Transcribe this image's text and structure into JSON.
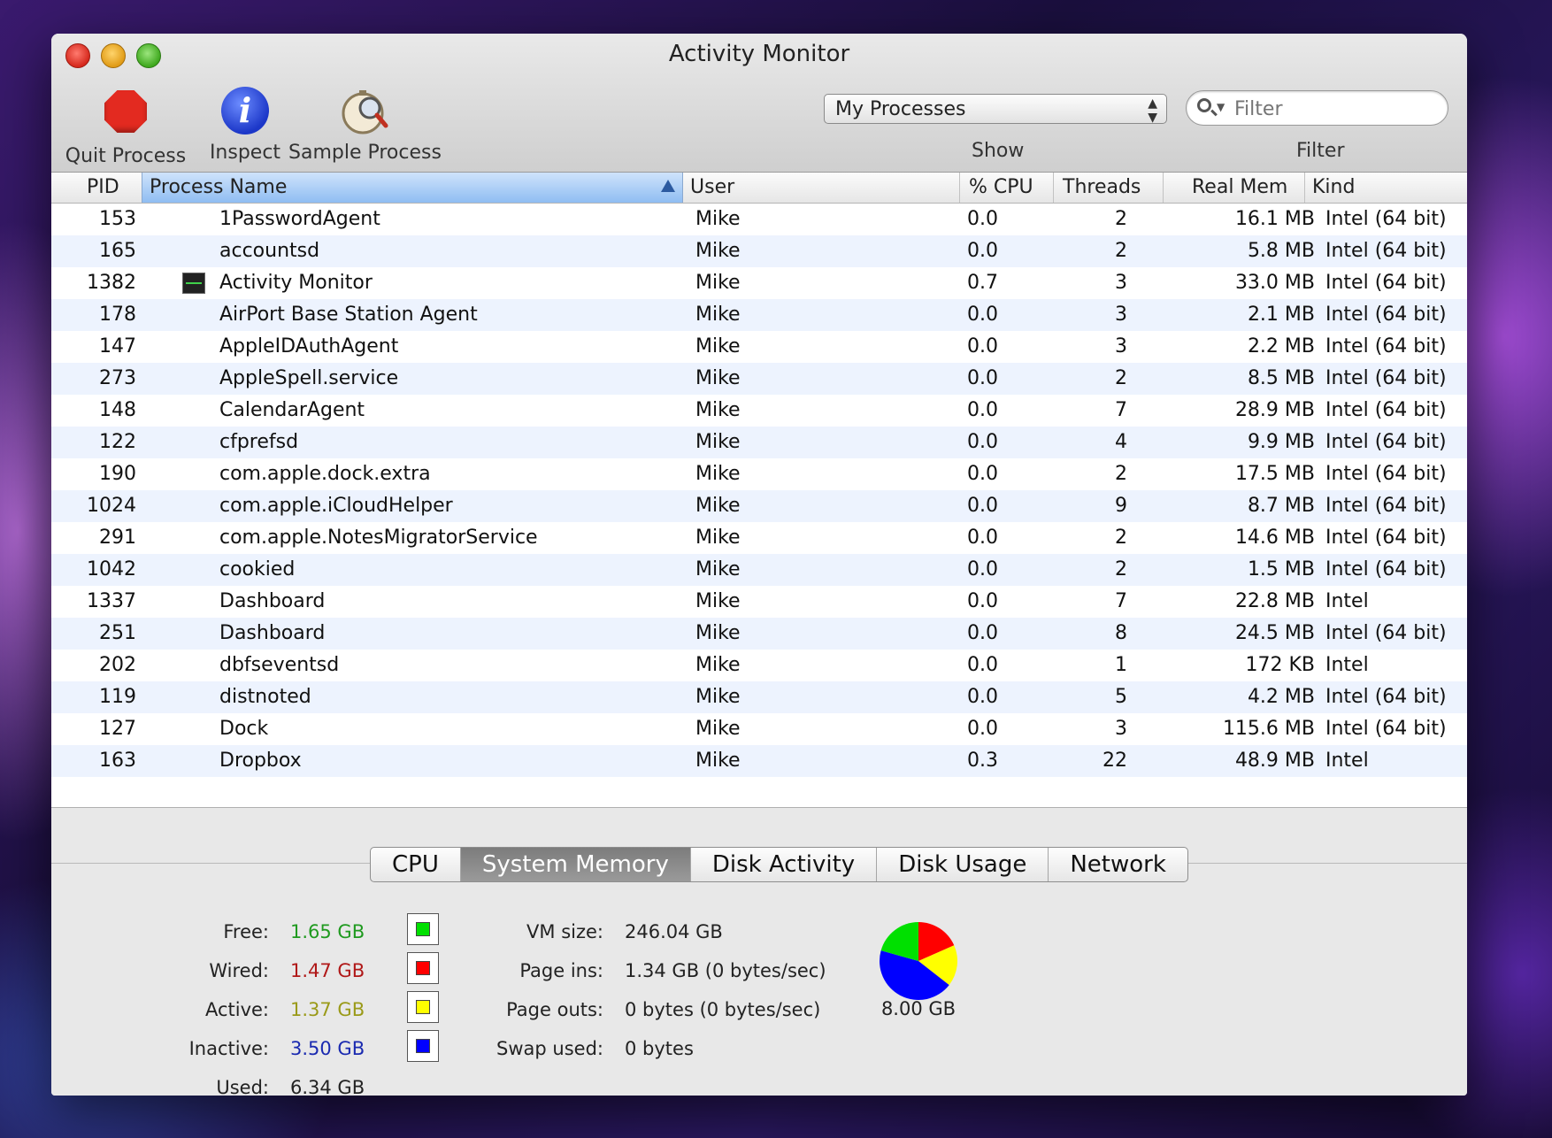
{
  "window": {
    "title": "Activity Monitor"
  },
  "toolbar": {
    "quit_label": "Quit Process",
    "inspect_label": "Inspect",
    "sample_label": "Sample Process",
    "show_value": "My Processes",
    "show_label": "Show",
    "filter_placeholder": "Filter",
    "filter_label": "Filter"
  },
  "table": {
    "columns": {
      "pid": "PID",
      "name": "Process Name",
      "user": "User",
      "cpu": "% CPU",
      "threads": "Threads",
      "mem": "Real Mem",
      "kind": "Kind"
    },
    "rows": [
      {
        "pid": "153",
        "name": "1PasswordAgent",
        "user": "Mike",
        "cpu": "0.0",
        "threads": "2",
        "mem": "16.1 MB",
        "kind": "Intel (64 bit)"
      },
      {
        "pid": "165",
        "name": "accountsd",
        "user": "Mike",
        "cpu": "0.0",
        "threads": "2",
        "mem": "5.8 MB",
        "kind": "Intel (64 bit)"
      },
      {
        "pid": "1382",
        "name": "Activity Monitor",
        "user": "Mike",
        "cpu": "0.7",
        "threads": "3",
        "mem": "33.0 MB",
        "kind": "Intel (64 bit)"
      },
      {
        "pid": "178",
        "name": "AirPort Base Station Agent",
        "user": "Mike",
        "cpu": "0.0",
        "threads": "3",
        "mem": "2.1 MB",
        "kind": "Intel (64 bit)"
      },
      {
        "pid": "147",
        "name": "AppleIDAuthAgent",
        "user": "Mike",
        "cpu": "0.0",
        "threads": "3",
        "mem": "2.2 MB",
        "kind": "Intel (64 bit)"
      },
      {
        "pid": "273",
        "name": "AppleSpell.service",
        "user": "Mike",
        "cpu": "0.0",
        "threads": "2",
        "mem": "8.5 MB",
        "kind": "Intel (64 bit)"
      },
      {
        "pid": "148",
        "name": "CalendarAgent",
        "user": "Mike",
        "cpu": "0.0",
        "threads": "7",
        "mem": "28.9 MB",
        "kind": "Intel (64 bit)"
      },
      {
        "pid": "122",
        "name": "cfprefsd",
        "user": "Mike",
        "cpu": "0.0",
        "threads": "4",
        "mem": "9.9 MB",
        "kind": "Intel (64 bit)"
      },
      {
        "pid": "190",
        "name": "com.apple.dock.extra",
        "user": "Mike",
        "cpu": "0.0",
        "threads": "2",
        "mem": "17.5 MB",
        "kind": "Intel (64 bit)"
      },
      {
        "pid": "1024",
        "name": "com.apple.iCloudHelper",
        "user": "Mike",
        "cpu": "0.0",
        "threads": "9",
        "mem": "8.7 MB",
        "kind": "Intel (64 bit)"
      },
      {
        "pid": "291",
        "name": "com.apple.NotesMigratorService",
        "user": "Mike",
        "cpu": "0.0",
        "threads": "2",
        "mem": "14.6 MB",
        "kind": "Intel (64 bit)"
      },
      {
        "pid": "1042",
        "name": "cookied",
        "user": "Mike",
        "cpu": "0.0",
        "threads": "2",
        "mem": "1.5 MB",
        "kind": "Intel (64 bit)"
      },
      {
        "pid": "1337",
        "name": "Dashboard",
        "user": "Mike",
        "cpu": "0.0",
        "threads": "7",
        "mem": "22.8 MB",
        "kind": "Intel"
      },
      {
        "pid": "251",
        "name": "Dashboard",
        "user": "Mike",
        "cpu": "0.0",
        "threads": "8",
        "mem": "24.5 MB",
        "kind": "Intel (64 bit)"
      },
      {
        "pid": "202",
        "name": "dbfseventsd",
        "user": "Mike",
        "cpu": "0.0",
        "threads": "1",
        "mem": "172 KB",
        "kind": "Intel"
      },
      {
        "pid": "119",
        "name": "distnoted",
        "user": "Mike",
        "cpu": "0.0",
        "threads": "5",
        "mem": "4.2 MB",
        "kind": "Intel (64 bit)"
      },
      {
        "pid": "127",
        "name": "Dock",
        "user": "Mike",
        "cpu": "0.0",
        "threads": "3",
        "mem": "115.6 MB",
        "kind": "Intel (64 bit)"
      },
      {
        "pid": "163",
        "name": "Dropbox",
        "user": "Mike",
        "cpu": "0.3",
        "threads": "22",
        "mem": "48.9 MB",
        "kind": "Intel"
      }
    ]
  },
  "tabs": [
    "CPU",
    "System Memory",
    "Disk Activity",
    "Disk Usage",
    "Network"
  ],
  "active_tab": "System Memory",
  "memory": {
    "free": {
      "label": "Free:",
      "value": "1.65 GB",
      "color": "#1f9a1f",
      "swatch": "#00e000"
    },
    "wired": {
      "label": "Wired:",
      "value": "1.47 GB",
      "color": "#b01818",
      "swatch": "#ff0000"
    },
    "active": {
      "label": "Active:",
      "value": "1.37 GB",
      "color": "#9a9a18",
      "swatch": "#ffff00"
    },
    "inactive": {
      "label": "Inactive:",
      "value": "3.50 GB",
      "color": "#1a2ab0",
      "swatch": "#0000ff"
    },
    "used": {
      "label": "Used:",
      "value": "6.34 GB"
    },
    "vm_size": {
      "label": "VM size:",
      "value": "246.04 GB"
    },
    "page_ins": {
      "label": "Page ins:",
      "value": "1.34 GB (0 bytes/sec)"
    },
    "page_outs": {
      "label": "Page outs:",
      "value": "0 bytes (0 bytes/sec)"
    },
    "swap_used": {
      "label": "Swap used:",
      "value": "0 bytes"
    },
    "total": "8.00 GB"
  }
}
